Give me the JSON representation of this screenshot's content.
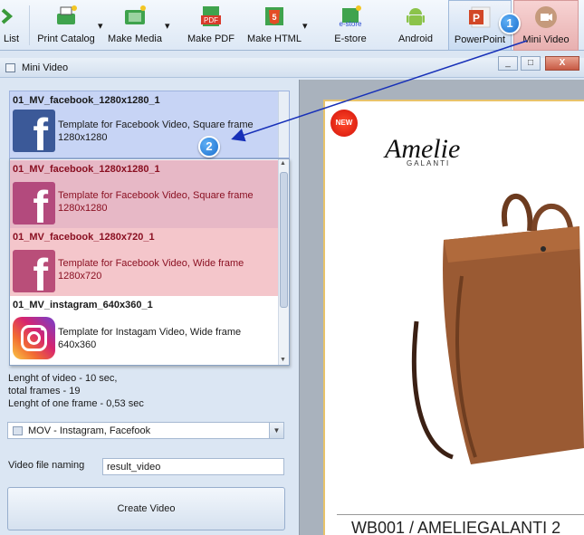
{
  "toolbar": {
    "items": [
      {
        "label": "List",
        "icon": "list-arrow-icon"
      },
      {
        "label": "Print Catalog",
        "icon": "print-catalog-icon"
      },
      {
        "label": "Make Media",
        "icon": "make-media-icon"
      },
      {
        "label": "Make PDF",
        "icon": "pdf-icon"
      },
      {
        "label": "Make HTML",
        "icon": "html5-icon"
      },
      {
        "label": "E-store",
        "icon": "estore-icon"
      },
      {
        "label": "Android",
        "icon": "android-icon"
      },
      {
        "label": "PowerPoint",
        "icon": "powerpoint-icon"
      },
      {
        "label": "Mini Video",
        "icon": "mini-video-icon"
      }
    ],
    "estore_icon_text": "e-store",
    "pdf_icon_text": "PDF",
    "html_icon_text": "5",
    "ppt_icon_text": "P"
  },
  "window": {
    "title": "Mini Video",
    "controls": [
      "_",
      "□",
      "X"
    ]
  },
  "selected_template": {
    "name": "01_MV_facebook_1280x1280_1",
    "description_line1": "Template for Facebook Video, Square frame",
    "description_line2": "1280x1280"
  },
  "template_list": [
    {
      "name": "01_MV_facebook_1280x1280_1",
      "line1": "Template for Facebook Video, Square frame",
      "line2": "1280x1280",
      "icon": "facebook-icon"
    },
    {
      "name": "01_MV_facebook_1280x720_1",
      "line1": "Template for Facebook Video, Wide frame",
      "line2": "1280x720",
      "icon": "facebook-icon"
    },
    {
      "name": "01_MV_instagram_640x360_1",
      "line1": "Template for Instagam Video, Wide frame",
      "line2": "640x360",
      "icon": "instagram-icon"
    }
  ],
  "video_info": {
    "length": "Lenght of video - 10 sec,",
    "frames": "total frames - 19",
    "frame_length": "Lenght of one frame  - 0,53 sec"
  },
  "format_select": {
    "value": "MOV - Instagram, Facefook"
  },
  "naming": {
    "label": "Video file naming",
    "value": "result_video"
  },
  "create_button": {
    "label": "Create Video"
  },
  "preview": {
    "badge": "NEW",
    "brand": "Amelie",
    "brand_sub": "GALANTI",
    "product_text": "WB001  /  AMELIEGALANTI 2"
  },
  "callouts": [
    "1",
    "2"
  ],
  "colors": {
    "callout": "#1b6fcf",
    "arrow": "#1730b8",
    "highlight_selected": "#c7d4f5",
    "highlight_hover": "#e7b8c6"
  }
}
